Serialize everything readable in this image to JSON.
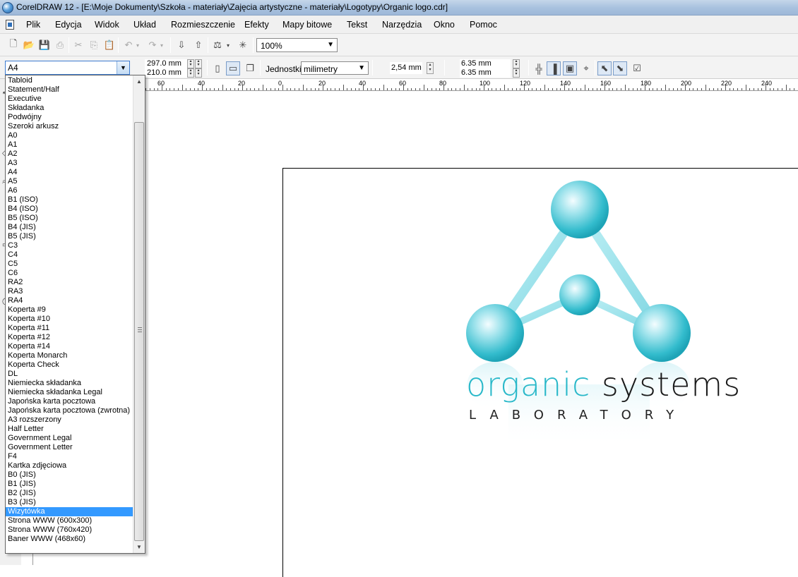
{
  "window": {
    "title": "CorelDRAW 12 - [E:\\Moje Dokumenty\\Szkoła - materiały\\Zajęcia artystyczne - materiały\\Logotypy\\Organic logo.cdr]"
  },
  "menu": [
    "Plik",
    "Edycja",
    "Widok",
    "Układ",
    "Rozmieszczenie",
    "Efekty",
    "Mapy bitowe",
    "Tekst",
    "Narzędzia",
    "Okno",
    "Pomoc"
  ],
  "toolbar": {
    "zoom": "100%"
  },
  "property_bar": {
    "page_size": "A4",
    "width": "297.0 mm",
    "height": "210.0 mm",
    "units_label": "Jednostki:",
    "units": "milimetry",
    "nudge": "2,54 mm",
    "dup_x": "6.35 mm",
    "dup_y": "6.35 mm"
  },
  "ruler": {
    "labels": [
      "60",
      "40",
      "20",
      "0",
      "20",
      "40",
      "60",
      "80",
      "100",
      "120",
      "140",
      "160",
      "180",
      "200",
      "220",
      "240"
    ]
  },
  "page_sizes": [
    "Tabloid",
    "Statement/Half",
    "Executive",
    "Składanka",
    "Podwójny",
    "Szeroki arkusz",
    "A0",
    "A1",
    "A2",
    "A3",
    "A4",
    "A5",
    "A6",
    "B1 (ISO)",
    "B4 (ISO)",
    "B5 (ISO)",
    "B4 (JIS)",
    "B5 (JIS)",
    "C3",
    "C4",
    "C5",
    "C6",
    "RA2",
    "RA3",
    "RA4",
    "Koperta #9",
    "Koperta #10",
    "Koperta #11",
    "Koperta #12",
    "Koperta #14",
    "Koperta Monarch",
    "Koperta Check",
    "DL",
    "Niemiecka składanka",
    "Niemiecka składanka Legal",
    "Japońska karta pocztowa",
    "Japońska karta pocztowa (zwrotna)",
    "A3 rozszerzony",
    "Half Letter",
    "Government Legal",
    "Government Letter",
    "F4",
    "Kartka zdjęciowa",
    "B0 (JIS)",
    "B1 (JIS)",
    "B2 (JIS)",
    "B3 (JIS)",
    "Wizytówka",
    "Strona WWW (600x300)",
    "Strona WWW (760x420)",
    "Baner WWW (468x60)"
  ],
  "selected_page_size": "Wizytówka",
  "logo": {
    "word1": "organic",
    "word2": "systems",
    "tagline": "LABORATORY"
  },
  "colors": {
    "accent": "#29b8c9",
    "selection": "#3399ff"
  }
}
